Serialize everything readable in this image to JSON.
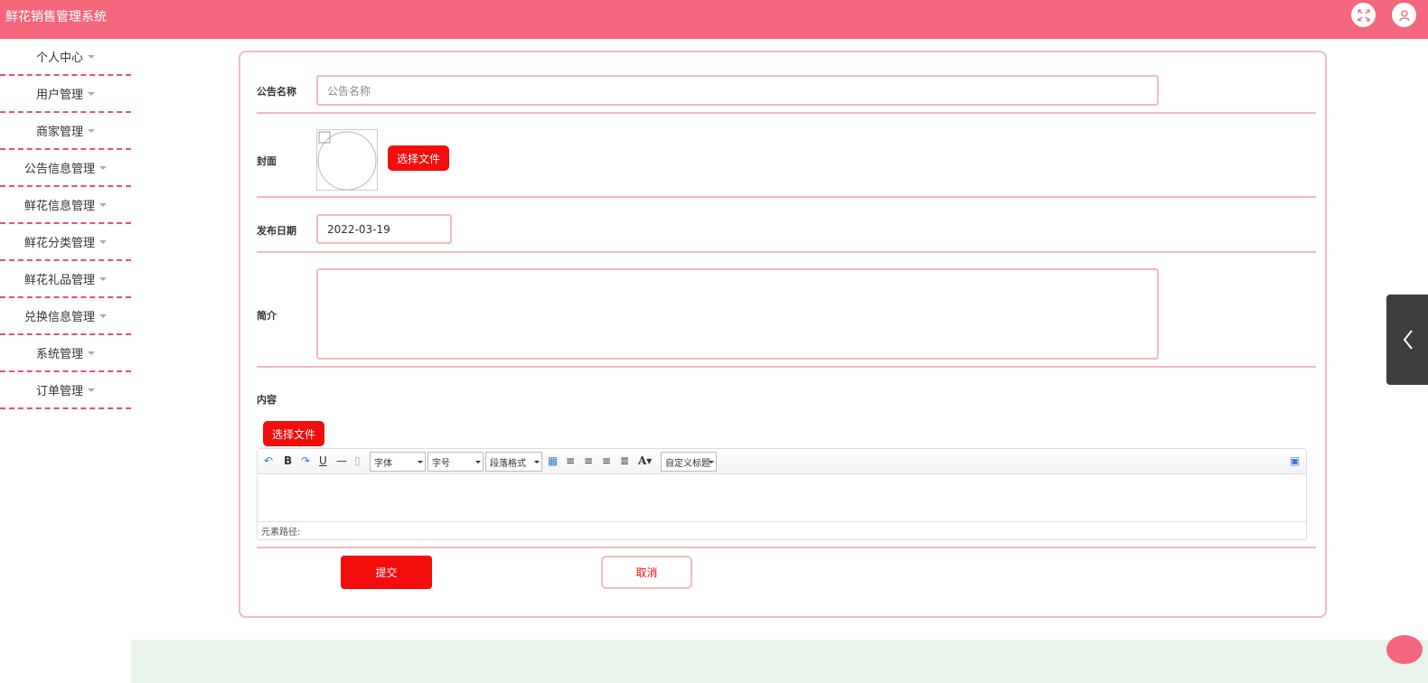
{
  "app": {
    "title": "鲜花销售管理系统"
  },
  "sidebar": {
    "items": [
      {
        "label": "个人中心"
      },
      {
        "label": "用户管理"
      },
      {
        "label": "商家管理"
      },
      {
        "label": "公告信息管理"
      },
      {
        "label": "鲜花信息管理"
      },
      {
        "label": "鲜花分类管理"
      },
      {
        "label": "鲜花礼品管理"
      },
      {
        "label": "兑换信息管理"
      },
      {
        "label": "系统管理"
      },
      {
        "label": "订单管理"
      }
    ]
  },
  "form": {
    "name_label": "公告名称",
    "name_placeholder": "公告名称",
    "cover_label": "封面",
    "cover_button": "选择文件",
    "date_label": "发布日期",
    "date_value": "2022-03-19",
    "intro_label": "简介",
    "content_label": "内容",
    "content_file_button": "选择文件",
    "submit_label": "提交",
    "cancel_label": "取消"
  },
  "editor": {
    "font_select": "字体",
    "size_select": "字号",
    "paragraph_select": "段落格式",
    "custom_title_select": "自定义标题",
    "status_path": "元素路径:"
  },
  "colors": {
    "header_bg": "#f4677d",
    "accent_red": "#f50c0c",
    "border_pink": "#f3b8bf",
    "divider_dashed": "#e8506a"
  }
}
